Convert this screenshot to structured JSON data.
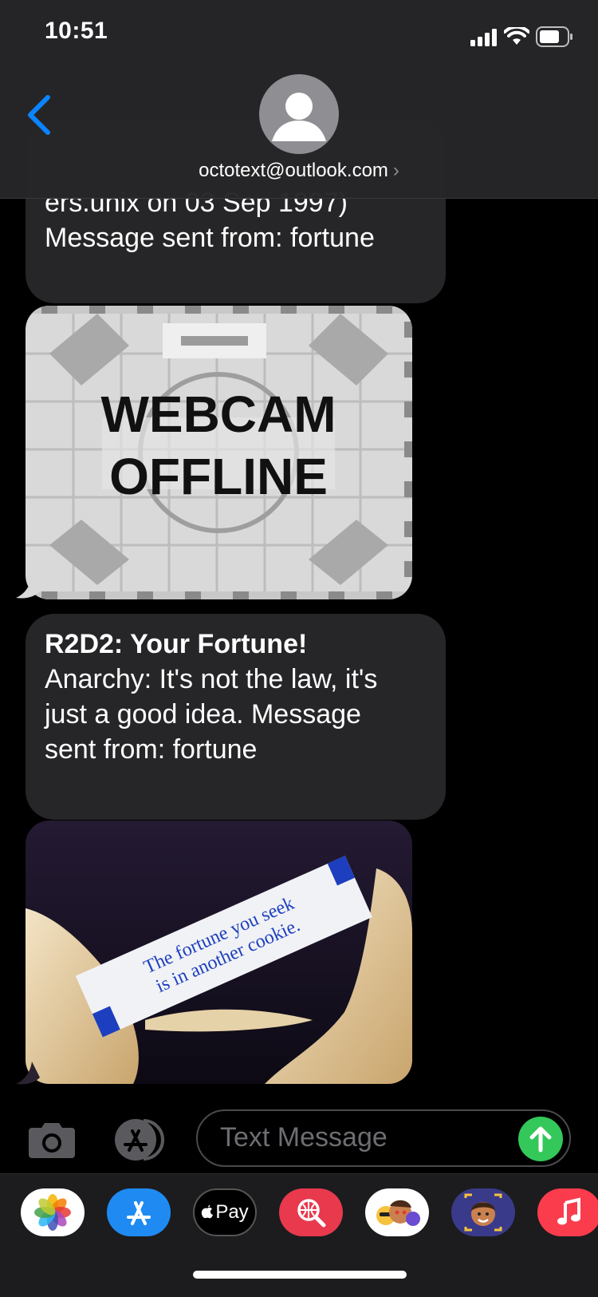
{
  "status": {
    "time": "10:51"
  },
  "header": {
    "contact": "octotext@outlook.com",
    "chevron": "›"
  },
  "messages": {
    "m1": {
      "text_line1": "ers.unix on 03 Sep 1997)",
      "text_line2": "Message sent from: fortune"
    },
    "m2": {
      "title": "WEBCAM",
      "subtitle": "OFFLINE"
    },
    "m3": {
      "heading": "R2D2: Your Fortune!",
      "body_lines": [
        "Anarchy: It's not the law, it's",
        "just a good idea. Message",
        "sent from: fortune"
      ]
    },
    "m4": {
      "slip_line1": "The fortune you seek",
      "slip_line2": "is in another cookie."
    }
  },
  "input": {
    "placeholder": "Text Message"
  },
  "drawer": {
    "apple_pay_label": "Pay"
  },
  "colors": {
    "accent": "#0a84ff",
    "bubble": "#262628",
    "send": "#34c759"
  }
}
